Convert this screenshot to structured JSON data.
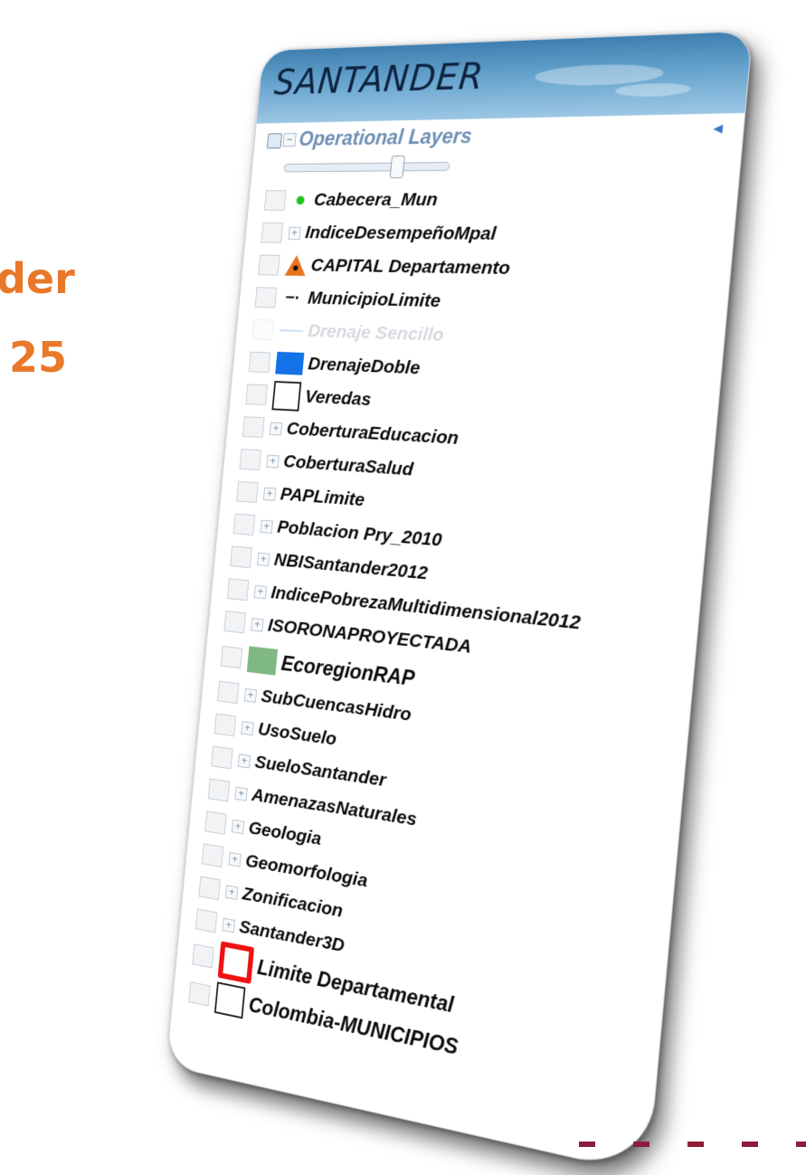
{
  "background_text": {
    "line1": "der",
    "line2": "25"
  },
  "panel": {
    "title": "SANTANDER",
    "root_label": "Operational Layers",
    "collapse_symbol": "−",
    "panel_collapse_icon": "◄"
  },
  "layers": [
    {
      "label": "Cabecera_Mun",
      "symbol": "green-dot"
    },
    {
      "label": "IndiceDesempeñoMpal",
      "symbol": "expand",
      "expand": "+"
    },
    {
      "label": "CAPITAL Departamento",
      "symbol": "orange-triangle"
    },
    {
      "label": "MunicipioLimite",
      "symbol": "dash-line",
      "glyph": "−·"
    },
    {
      "label": "Drenaje Sencillo",
      "symbol": "light-line"
    },
    {
      "label": "DrenajeDoble",
      "symbol": "blue-square"
    },
    {
      "label": "Veredas",
      "symbol": "outline-square"
    },
    {
      "label": "CoberturaEducacion",
      "symbol": "expand",
      "expand": "+"
    },
    {
      "label": "CoberturaSalud",
      "symbol": "expand",
      "expand": "+"
    },
    {
      "label": "PAPLimite",
      "symbol": "expand",
      "expand": "+"
    },
    {
      "label": "Poblacion Pry_2010",
      "symbol": "expand",
      "expand": "+"
    },
    {
      "label": "NBISantander2012",
      "symbol": "expand",
      "expand": "+"
    },
    {
      "label": "IndicePobrezaMultidimensional2012",
      "symbol": "expand",
      "expand": "+"
    },
    {
      "label": "ISORONAPROYECTADA",
      "symbol": "expand",
      "expand": "+"
    },
    {
      "label": "EcoregionRAP",
      "symbol": "green-square"
    },
    {
      "label": "SubCuencasHidro",
      "symbol": "expand",
      "expand": "+"
    },
    {
      "label": "UsoSuelo",
      "symbol": "expand",
      "expand": "+"
    },
    {
      "label": "SueloSantander",
      "symbol": "expand",
      "expand": "+"
    },
    {
      "label": "AmenazasNaturales",
      "symbol": "expand",
      "expand": "+"
    },
    {
      "label": "Geologia",
      "symbol": "expand",
      "expand": "+"
    },
    {
      "label": "Geomorfologia",
      "symbol": "expand",
      "expand": "+"
    },
    {
      "label": "Zonificacion",
      "symbol": "expand",
      "expand": "+"
    },
    {
      "label": "Santander3D",
      "symbol": "expand",
      "expand": "+"
    },
    {
      "label": "Limite Departamental",
      "symbol": "red-square"
    },
    {
      "label": "Colombia-MUNICIPIOS",
      "symbol": "outline-square-2"
    }
  ],
  "colors": {
    "accent_orange": "#e8782a",
    "header_blue": "#4f8fc0",
    "layer_blue": "#1472e8",
    "layer_green": "#7fb883",
    "layer_red": "#ef1111"
  }
}
